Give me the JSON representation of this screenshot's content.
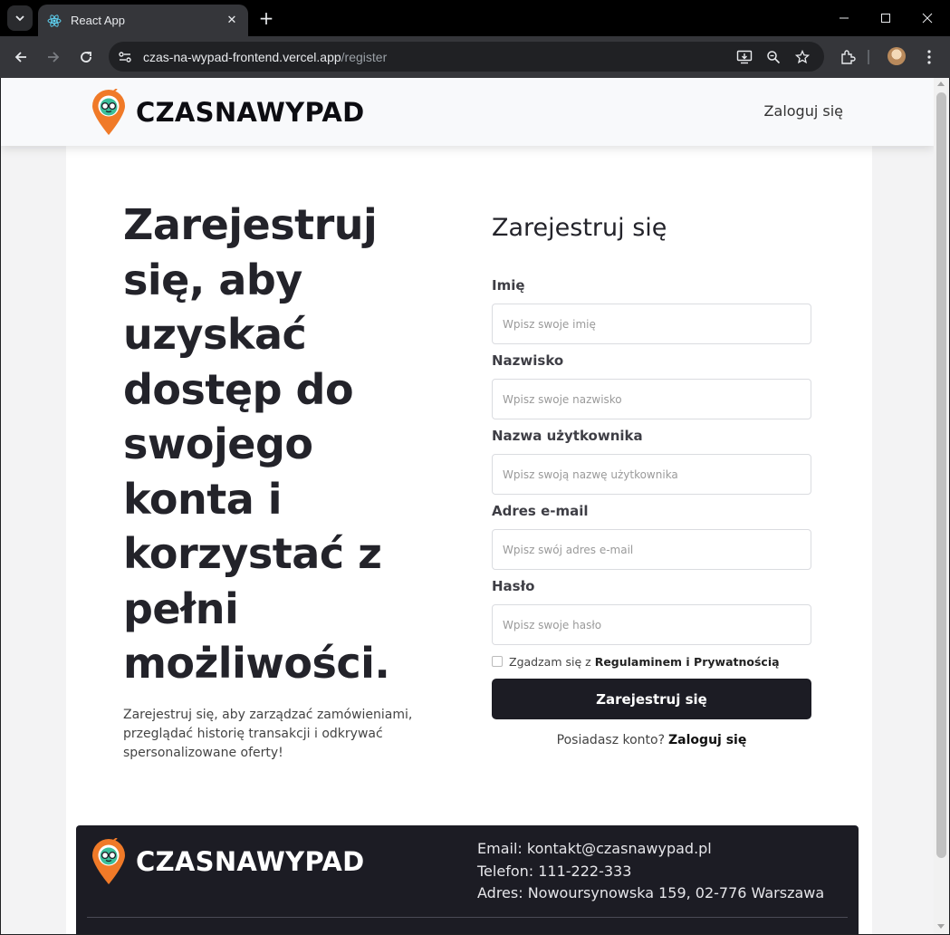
{
  "browser": {
    "tab_title": "React App",
    "url_host": "czas-na-wypad-frontend.vercel.app",
    "url_path": "/register"
  },
  "header": {
    "logo_text": "CZASNAWYPAD",
    "login_link": "Zaloguj się"
  },
  "hero": {
    "title": "Zarejestruj się, aby uzyskać dostęp do swojego konta i korzystać z pełni możliwości.",
    "subtitle": "Zarejestruj się, aby zarządzać zamówieniami, przeglądać historię transakcji i odkrywać spersonalizowane oferty!"
  },
  "form": {
    "title": "Zarejestruj się",
    "fields": [
      {
        "label": "Imię",
        "placeholder": "Wpisz swoje imię",
        "value": ""
      },
      {
        "label": "Nazwisko",
        "placeholder": "Wpisz swoje nazwisko",
        "value": ""
      },
      {
        "label": "Nazwa użytkownika",
        "placeholder": "Wpisz swoją nazwę użytkownika",
        "value": ""
      },
      {
        "label": "Adres e-mail",
        "placeholder": "Wpisz swój adres e-mail",
        "value": ""
      },
      {
        "label": "Hasło",
        "placeholder": "Wpisz swoje hasło",
        "value": ""
      }
    ],
    "terms_prefix": "Zgadzam się z",
    "terms_link": "Regulaminem i Prywatnością",
    "submit_label": "Zarejestruj się",
    "have_account_text": "Posiadasz konto?",
    "have_account_link": "Zaloguj się"
  },
  "footer": {
    "logo_text": "CZASNAWYPAD",
    "email": "Email: kontakt@czasnawypad.pl",
    "phone": "Telefon: 111-222-333",
    "address": "Adres: Nowoursynowska 159, 02-776 Warszawa"
  },
  "colors": {
    "brand_orange": "#f07a28",
    "logo_green": "#3bbf9a",
    "dark": "#1c1c24"
  }
}
